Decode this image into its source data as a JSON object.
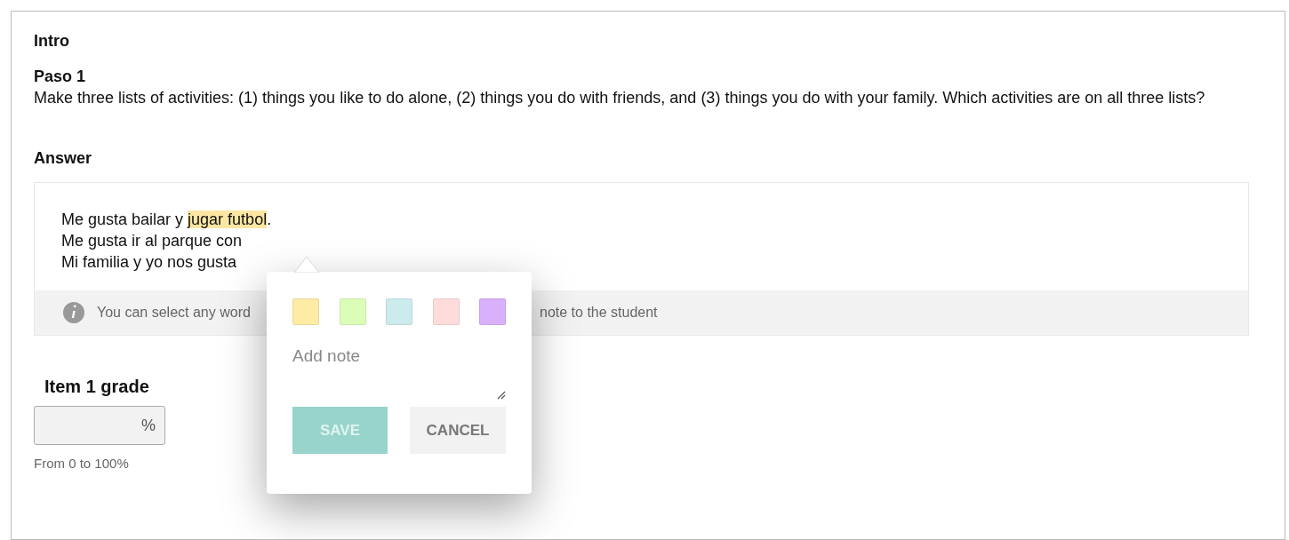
{
  "intro": {
    "title": "Intro"
  },
  "step": {
    "title": "Paso 1",
    "text": "Make three lists of activities: (1) things you like to do alone, (2) things you do with friends, and (3) things you do with your family. Which activities are on all three lists?"
  },
  "answer": {
    "title": "Answer",
    "lines": [
      [
        {
          "text": "Me gusta bailar y ",
          "highlighted": false
        },
        {
          "text": "jugar futbol",
          "highlighted": true
        },
        {
          "text": ".",
          "highlighted": false
        }
      ],
      [
        {
          "text": "Me gusta ir al parque con",
          "highlighted": false
        }
      ],
      [
        {
          "text": "Mi familia y yo nos gusta",
          "highlighted": false
        }
      ]
    ],
    "info": [
      "You can select any word",
      "note to the student"
    ]
  },
  "note_popup": {
    "swatches": [
      {
        "color": "#fdeba6"
      },
      {
        "color": "#dcfdb8"
      },
      {
        "color": "#cbebed"
      },
      {
        "color": "#fedcdc"
      },
      {
        "color": "#d8b0fc"
      }
    ],
    "placeholder": "Add note",
    "buttons": [
      {
        "label": "SAVE",
        "kind": "primary",
        "disabled": true
      },
      {
        "label": "CANCEL",
        "kind": "secondary",
        "disabled": false
      }
    ]
  },
  "grade": {
    "title": "Item 1 grade",
    "unit": "%",
    "hint": "From 0 to 100%"
  }
}
